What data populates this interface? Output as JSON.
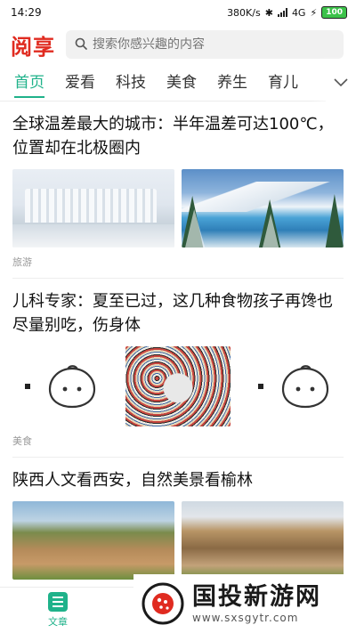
{
  "status_bar": {
    "time": "14:29",
    "speed": "380K/s",
    "network": "4G",
    "battery": "100"
  },
  "header": {
    "logo": "阅享",
    "search_placeholder": "搜索你感兴趣的内容"
  },
  "tabs": [
    "首页",
    "爱看",
    "科技",
    "美食",
    "养生",
    "育儿"
  ],
  "articles": [
    {
      "title": "全球温差最大的城市：半年温差可达100℃，位置却在北极圈内",
      "category": "旅游"
    },
    {
      "title": "儿科专家：夏至已过，这几种食物孩子再馋也尽量别吃，伤身体",
      "category": "美食"
    },
    {
      "title": "陕西人文看西安，自然美景看榆林",
      "category": ""
    }
  ],
  "bottom_nav": {
    "label": "文章"
  },
  "watermark": {
    "title": "国投新游网",
    "url": "www.sxsgytr.com"
  },
  "colors": {
    "accent": "#1fb28a",
    "logo": "#e02b20"
  }
}
